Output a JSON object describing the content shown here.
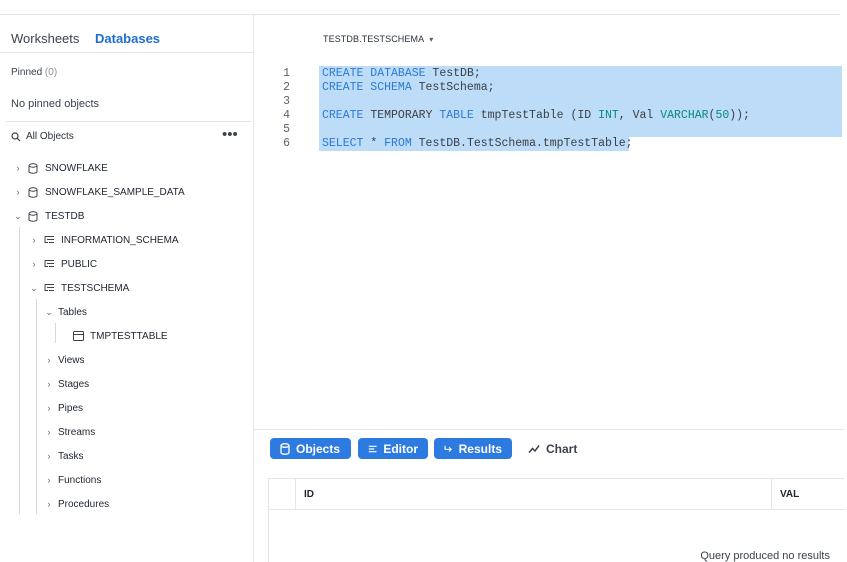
{
  "tabs": {
    "worksheets": "Worksheets",
    "databases": "Databases"
  },
  "pinned": {
    "label": "Pinned",
    "count": "(0)",
    "empty": "No pinned objects"
  },
  "all_objects": {
    "label": "All Objects",
    "more": "•••"
  },
  "tree": {
    "snowflake": "SNOWFLAKE",
    "sample": "SNOWFLAKE_SAMPLE_DATA",
    "testdb": "TESTDB",
    "information_schema": "INFORMATION_SCHEMA",
    "public": "PUBLIC",
    "testschema": "TESTSCHEMA",
    "tables": "Tables",
    "tmptesttable": "TMPTESTTABLE",
    "views": "Views",
    "stages": "Stages",
    "pipes": "Pipes",
    "streams": "Streams",
    "tasks": "Tasks",
    "functions": "Functions",
    "procedures": "Procedures"
  },
  "context": {
    "label": "TESTDB.TESTSCHEMA",
    "caret": "▾"
  },
  "editor": {
    "line_numbers": [
      "1",
      "2",
      "3",
      "4",
      "5",
      "6"
    ],
    "l1": {
      "kw": "CREATE DATABASE",
      "rest": " TestDB;"
    },
    "l2": {
      "kw": "CREATE SCHEMA",
      "rest": " TestSchema;"
    },
    "l4": {
      "a": "CREATE ",
      "b": "TEMPORARY ",
      "c": "TABLE",
      "d": " tmpTestTable (ID ",
      "e": "INT",
      "f": ", Val ",
      "g": "VARCHAR",
      "h": "(",
      "i": "50",
      "j": "));"
    },
    "l6": {
      "a": "SELECT",
      "b": " * ",
      "c": "FROM",
      "d": " TestDB.TestSchema.tmpTestTable;"
    }
  },
  "toolbar": {
    "objects": "Objects",
    "editor": "Editor",
    "results": "Results",
    "chart": "Chart"
  },
  "results": {
    "columns": [
      "ID",
      "VAL"
    ],
    "empty": "Query produced no results"
  },
  "colors": {
    "accent": "#2d7be0",
    "selection": "#bcdcf7",
    "keyword": "#2c7ad6",
    "type": "#0b8a7a"
  }
}
